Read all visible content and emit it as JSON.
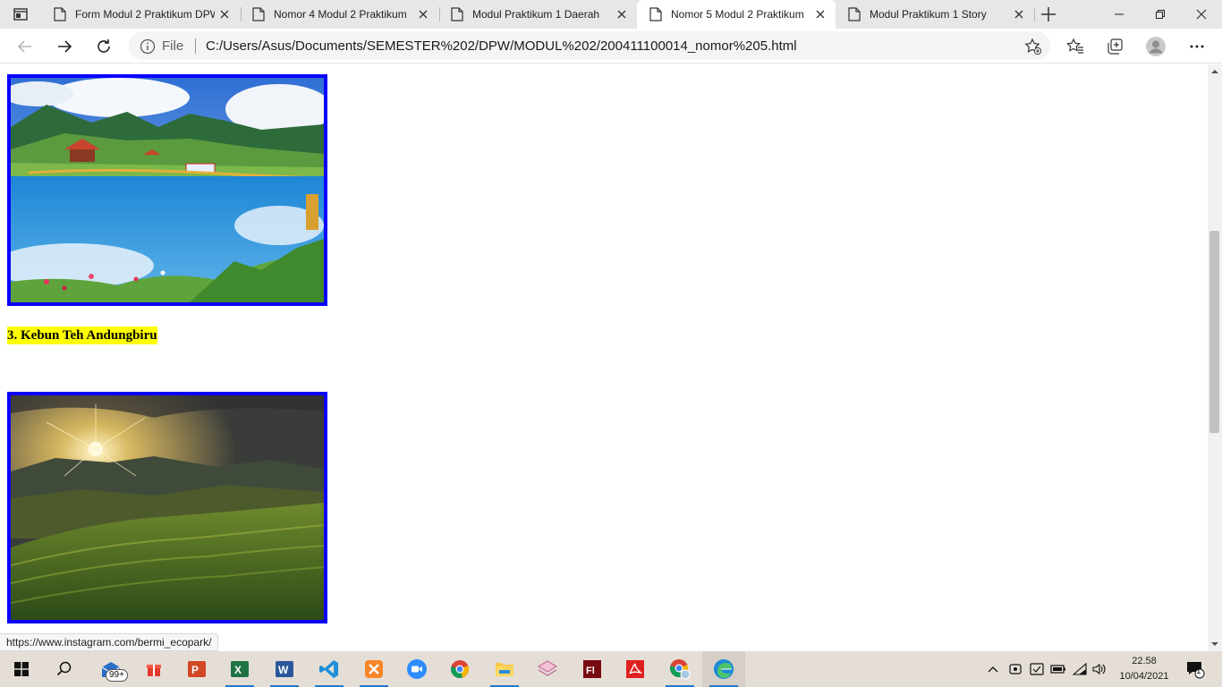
{
  "browser": {
    "tabs": [
      {
        "title": "Form Modul 2 Praktikum DPW",
        "active": false
      },
      {
        "title": "Nomor 4 Modul 2 Praktikum",
        "active": false
      },
      {
        "title": "Modul Praktikum 1 Daerah",
        "active": false
      },
      {
        "title": "Nomor 5 Modul 2 Praktikum",
        "active": true
      },
      {
        "title": "Modul Praktikum 1 Story",
        "active": false
      }
    ],
    "address": {
      "scheme_label": "File",
      "url": "C:/Users/Asus/Documents/SEMESTER%202/DPW/MODUL%202/200411100014_nomor%205.html"
    }
  },
  "page": {
    "section_heading": "3. Kebun Teh Andungbiru"
  },
  "status_bar": {
    "link": "https://www.instagram.com/bermi_ecopark/"
  },
  "taskbar": {
    "mail_badge": "99+",
    "clock_time": "22.58",
    "clock_date": "10/04/2021",
    "notification_count": "1"
  },
  "colors": {
    "image_border": "#0b00ff",
    "heading_highlight": "#ffff00"
  },
  "icons": [
    "tab-actions-icon",
    "page-icon",
    "close-icon",
    "plus-icon",
    "minimize-icon",
    "restore-icon",
    "back-icon",
    "forward-icon",
    "refresh-icon",
    "info-icon",
    "add-favorite-icon",
    "favorites-icon",
    "collections-icon",
    "profile-icon",
    "more-icon",
    "windows-start-icon",
    "search-icon"
  ]
}
